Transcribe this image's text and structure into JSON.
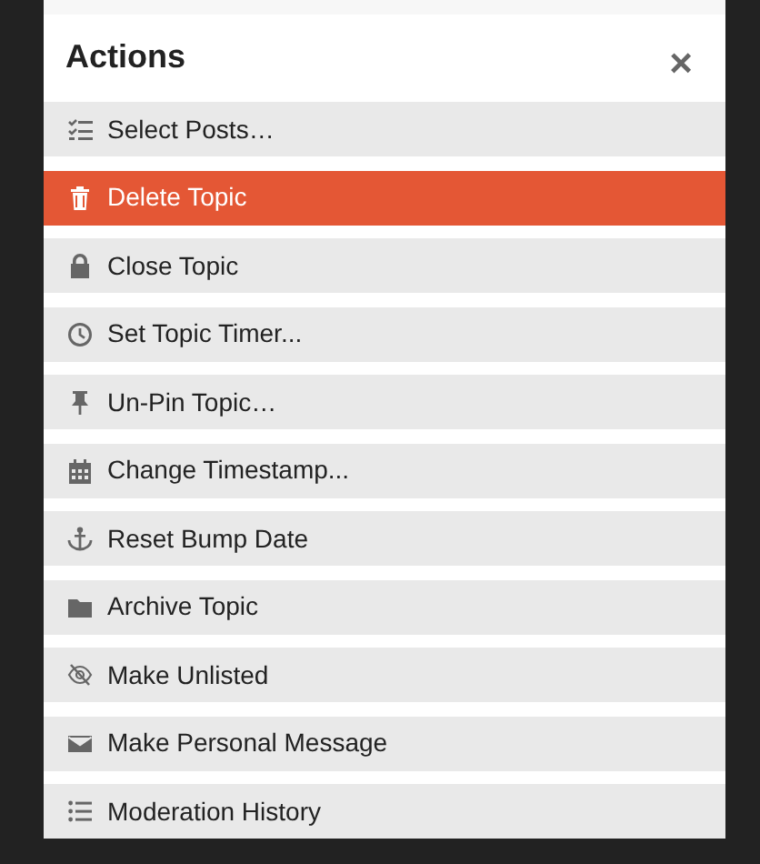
{
  "modal": {
    "title": "Actions",
    "close": "×"
  },
  "actions": [
    {
      "label": "Select Posts…",
      "selected": false
    },
    {
      "label": "Delete Topic",
      "selected": true
    },
    {
      "label": "Close Topic",
      "selected": false
    },
    {
      "label": "Set Topic Timer...",
      "selected": false
    },
    {
      "label": "Un-Pin Topic…",
      "selected": false
    },
    {
      "label": "Change Timestamp...",
      "selected": false
    },
    {
      "label": "Reset Bump Date",
      "selected": false
    },
    {
      "label": "Archive Topic",
      "selected": false
    },
    {
      "label": "Make Unlisted",
      "selected": false
    },
    {
      "label": "Make Personal Message",
      "selected": false
    },
    {
      "label": "Moderation History",
      "selected": false
    }
  ]
}
